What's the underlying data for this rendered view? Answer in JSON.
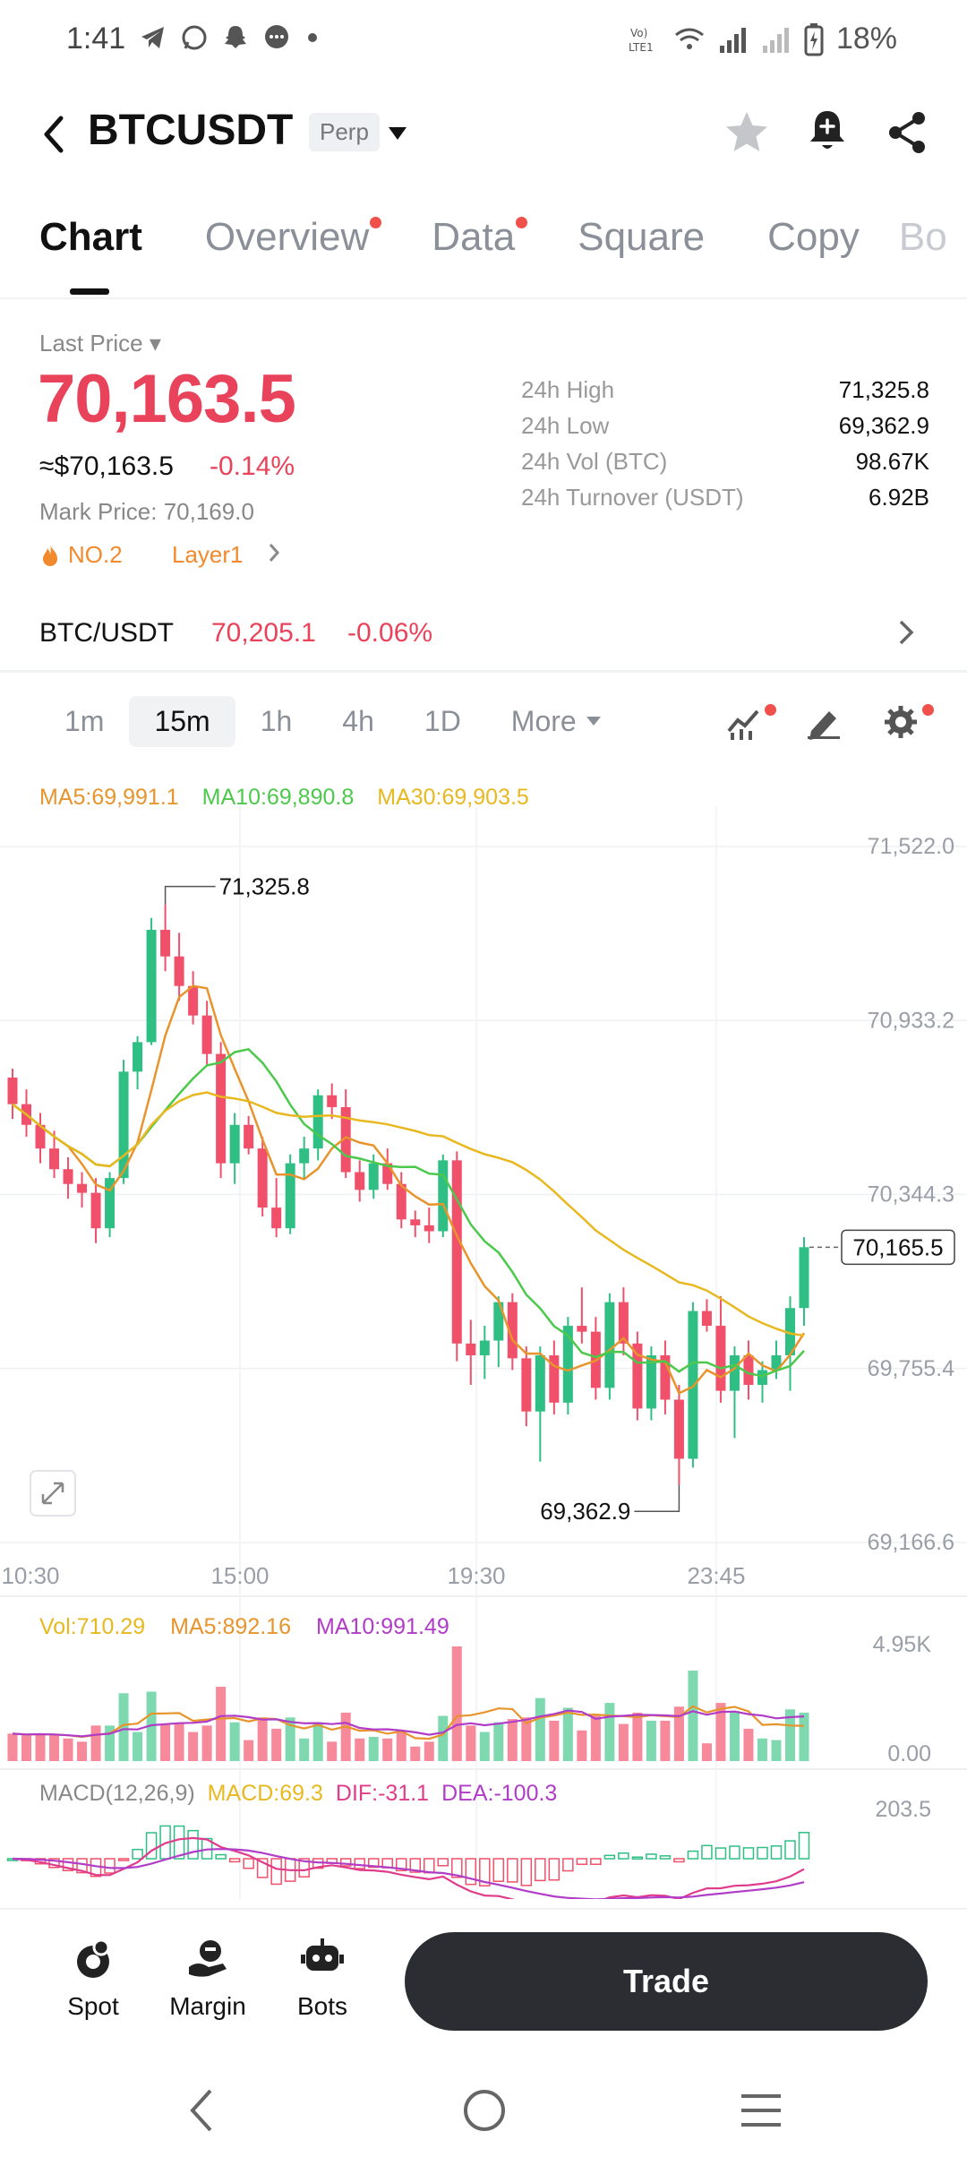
{
  "status_bar": {
    "time": "1:41",
    "battery": "18%"
  },
  "header": {
    "title": "BTCUSDT",
    "badge": "Perp"
  },
  "tabs": [
    {
      "label": "Chart",
      "active": true,
      "dot": false
    },
    {
      "label": "Overview",
      "active": false,
      "dot": true
    },
    {
      "label": "Data",
      "active": false,
      "dot": true
    },
    {
      "label": "Square",
      "active": false,
      "dot": false
    },
    {
      "label": "Copy",
      "active": false,
      "dot": false
    },
    {
      "label": "Bo",
      "active": false,
      "dot": false
    }
  ],
  "price": {
    "last_label": "Last Price",
    "last": "70,163.5",
    "usd": "≈$70,163.5",
    "change_pct": "-0.14%",
    "mark_label": "Mark Price:",
    "mark_value": "70,169.0",
    "rank": "NO.2",
    "layer": "Layer1"
  },
  "stats": [
    {
      "label": "24h High",
      "value": "71,325.8"
    },
    {
      "label": "24h Low",
      "value": "69,362.9"
    },
    {
      "label": "24h Vol (BTC)",
      "value": "98.67K"
    },
    {
      "label": "24h Turnover (USDT)",
      "value": "6.92B"
    }
  ],
  "spot": {
    "label": "BTC/USDT",
    "price": "70,205.1",
    "change_pct": "-0.06%"
  },
  "intervals": {
    "items": [
      "1m",
      "15m",
      "1h",
      "4h",
      "1D"
    ],
    "active": "15m",
    "more": "More"
  },
  "ma_legend": [
    {
      "text": "MA5:69,991.1",
      "color": "#e8942c"
    },
    {
      "text": "MA10:69,890.8",
      "color": "#4cc94c"
    },
    {
      "text": "MA30:69,903.5",
      "color": "#e8b820"
    }
  ],
  "volume_legend": [
    {
      "text": "Vol:710.29",
      "color": "#e8b820"
    },
    {
      "text": "MA5:892.16",
      "color": "#e8942c"
    },
    {
      "text": "MA10:991.49",
      "color": "#b03cc8"
    }
  ],
  "macd_legend": [
    {
      "text": "MACD(12,26,9)",
      "color": "#888888"
    },
    {
      "text": "MACD:69.3",
      "color": "#e8b820"
    },
    {
      "text": "DIF:-31.1",
      "color": "#e03c8c"
    },
    {
      "text": "DEA:-100.3",
      "color": "#b03cc8"
    }
  ],
  "colors": {
    "up": "#2fbf84",
    "down": "#f0506a",
    "ma5": "#e8942c",
    "ma10": "#4cc94c",
    "ma30": "#e8b820"
  },
  "chart_data": [
    {
      "type": "candlestick",
      "price_axis": [
        "71,522.0",
        "70,933.2",
        "70,344.3",
        "69,755.4",
        "69,166.6"
      ],
      "ylim": [
        69166.6,
        71522.0
      ],
      "time_labels": [
        "10:30",
        "15:00",
        "19:30",
        "23:45"
      ],
      "annotations": {
        "high": "71,325.8",
        "low": "69,362.9",
        "current": "70,165.5"
      },
      "candles": [
        [
          70740,
          70770,
          70600,
          70650
        ],
        [
          70650,
          70700,
          70540,
          70580
        ],
        [
          70580,
          70620,
          70450,
          70500
        ],
        [
          70500,
          70560,
          70400,
          70430
        ],
        [
          70430,
          70470,
          70330,
          70380
        ],
        [
          70380,
          70420,
          70300,
          70350
        ],
        [
          70350,
          70400,
          70180,
          70230
        ],
        [
          70230,
          70420,
          70200,
          70400
        ],
        [
          70400,
          70800,
          70380,
          70760
        ],
        [
          70760,
          70880,
          70700,
          70860
        ],
        [
          70860,
          71280,
          70850,
          71240
        ],
        [
          71240,
          71326,
          71100,
          71150
        ],
        [
          71150,
          71230,
          71000,
          71050
        ],
        [
          71050,
          71100,
          70920,
          70950
        ],
        [
          70950,
          71000,
          70780,
          70820
        ],
        [
          70820,
          70860,
          70400,
          70450
        ],
        [
          70450,
          70620,
          70380,
          70580
        ],
        [
          70580,
          70610,
          70480,
          70500
        ],
        [
          70500,
          70540,
          70270,
          70300
        ],
        [
          70300,
          70400,
          70200,
          70230
        ],
        [
          70230,
          70480,
          70210,
          70450
        ],
        [
          70450,
          70540,
          70400,
          70500
        ],
        [
          70500,
          70700,
          70460,
          70680
        ],
        [
          70680,
          70720,
          70600,
          70640
        ],
        [
          70640,
          70700,
          70400,
          70420
        ],
        [
          70420,
          70460,
          70320,
          70360
        ],
        [
          70360,
          70480,
          70330,
          70450
        ],
        [
          70450,
          70500,
          70360,
          70380
        ],
        [
          70380,
          70420,
          70230,
          70260
        ],
        [
          70260,
          70290,
          70200,
          70240
        ],
        [
          70240,
          70300,
          70180,
          70220
        ],
        [
          70220,
          70480,
          70200,
          70460
        ],
        [
          70460,
          70490,
          69780,
          69840
        ],
        [
          69840,
          69920,
          69700,
          69800
        ],
        [
          69800,
          69900,
          69720,
          69850
        ],
        [
          69850,
          70000,
          69760,
          69980
        ],
        [
          69980,
          70010,
          69750,
          69790
        ],
        [
          69790,
          69830,
          69560,
          69610
        ],
        [
          69610,
          69830,
          69440,
          69800
        ],
        [
          69800,
          69850,
          69600,
          69640
        ],
        [
          69640,
          69930,
          69600,
          69900
        ],
        [
          69900,
          70030,
          69840,
          69880
        ],
        [
          69880,
          69930,
          69650,
          69690
        ],
        [
          69690,
          70010,
          69650,
          69980
        ],
        [
          69980,
          70030,
          69800,
          69840
        ],
        [
          69840,
          69880,
          69580,
          69620
        ],
        [
          69620,
          69830,
          69580,
          69800
        ],
        [
          69800,
          69850,
          69600,
          69650
        ],
        [
          69650,
          69700,
          69363,
          69450
        ],
        [
          69450,
          69980,
          69420,
          69950
        ],
        [
          69950,
          69990,
          69880,
          69900
        ],
        [
          69900,
          70000,
          69640,
          69680
        ],
        [
          69680,
          69830,
          69520,
          69800
        ],
        [
          69800,
          69850,
          69650,
          69700
        ],
        [
          69700,
          69780,
          69640,
          69750
        ],
        [
          69750,
          69850,
          69720,
          69800
        ],
        [
          69800,
          70000,
          69680,
          69960
        ],
        [
          69960,
          70200,
          69900,
          70166
        ]
      ]
    },
    {
      "type": "bar",
      "title": "Volume",
      "axis": [
        "4.95K",
        "0.00"
      ],
      "ylim": [
        0,
        4950
      ]
    },
    {
      "type": "bar",
      "title": "MACD(12,26,9)",
      "axis": [
        "203.5"
      ]
    }
  ],
  "bottom_nav": {
    "spot": "Spot",
    "margin": "Margin",
    "bots": "Bots",
    "trade": "Trade"
  }
}
